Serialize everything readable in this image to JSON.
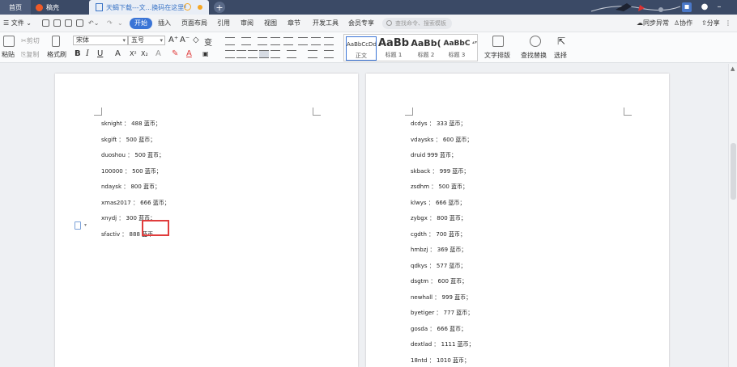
{
  "tabs": {
    "home": "首页",
    "draft": "稿壳",
    "doc": "天蝎下载---文...换码在这里!",
    "add": "+"
  },
  "menu": {
    "file": "文件",
    "items": [
      "开始",
      "插入",
      "页面布局",
      "引用",
      "审阅",
      "视图",
      "章节",
      "开发工具",
      "会员专享"
    ],
    "search_placeholder": "查找命令、搜索模板",
    "sync": "同步异常",
    "collab": "协作",
    "share": "分享"
  },
  "ribbon": {
    "paste": "粘贴",
    "cut": "剪切",
    "copy": "复制",
    "format_painter": "格式刷",
    "font_name": "宋体",
    "font_size": "五号",
    "bold": "B",
    "italic": "I",
    "underline": "U",
    "styles": [
      {
        "sample": "AaBbCcDd",
        "name": "正文"
      },
      {
        "sample": "AaBb",
        "name": "标题 1"
      },
      {
        "sample": "AaBb(",
        "name": "标题 2"
      },
      {
        "sample": "AaBbC",
        "name": "标题 3"
      }
    ],
    "text_layout": "文字排版",
    "find_replace": "查找替换",
    "select": "选择"
  },
  "left_page_lines": [
    "sknight ： 488 蓝币；",
    "skgift ： 500 蓝币；",
    "duoshou ： 500 蓝币；",
    "100000 ： 500 蓝币；",
    "ndaysk ： 800 蓝币；",
    "xmas2017 ： 666 蓝币；",
    "xnydj ： 300 蓝币；",
    "sfactiv ： 888 蓝币"
  ],
  "right_page_lines": [
    "dcdys ： 333 蓝币；",
    "vdaysks ： 600 蓝币；",
    "druid 999 蓝币；",
    "skback ： 999 蓝币；",
    "zsdhm ： 500 蓝币；",
    "klwys ： 666 蓝币；",
    "zybgx ： 800 蓝币；",
    "cgdth ： 700 蓝币；",
    "hmbzj ： 369 蓝币；",
    "qdkys ： 577 蓝币；",
    "dsgtm ： 600 蓝币；",
    "newhall ： 999 蓝币；",
    "byetiger ： 777 蓝币；",
    "gosda ： 666 蓝币；",
    "dextlad ： 1111 蓝币；",
    "18ntd ： 1010 蓝币；"
  ]
}
